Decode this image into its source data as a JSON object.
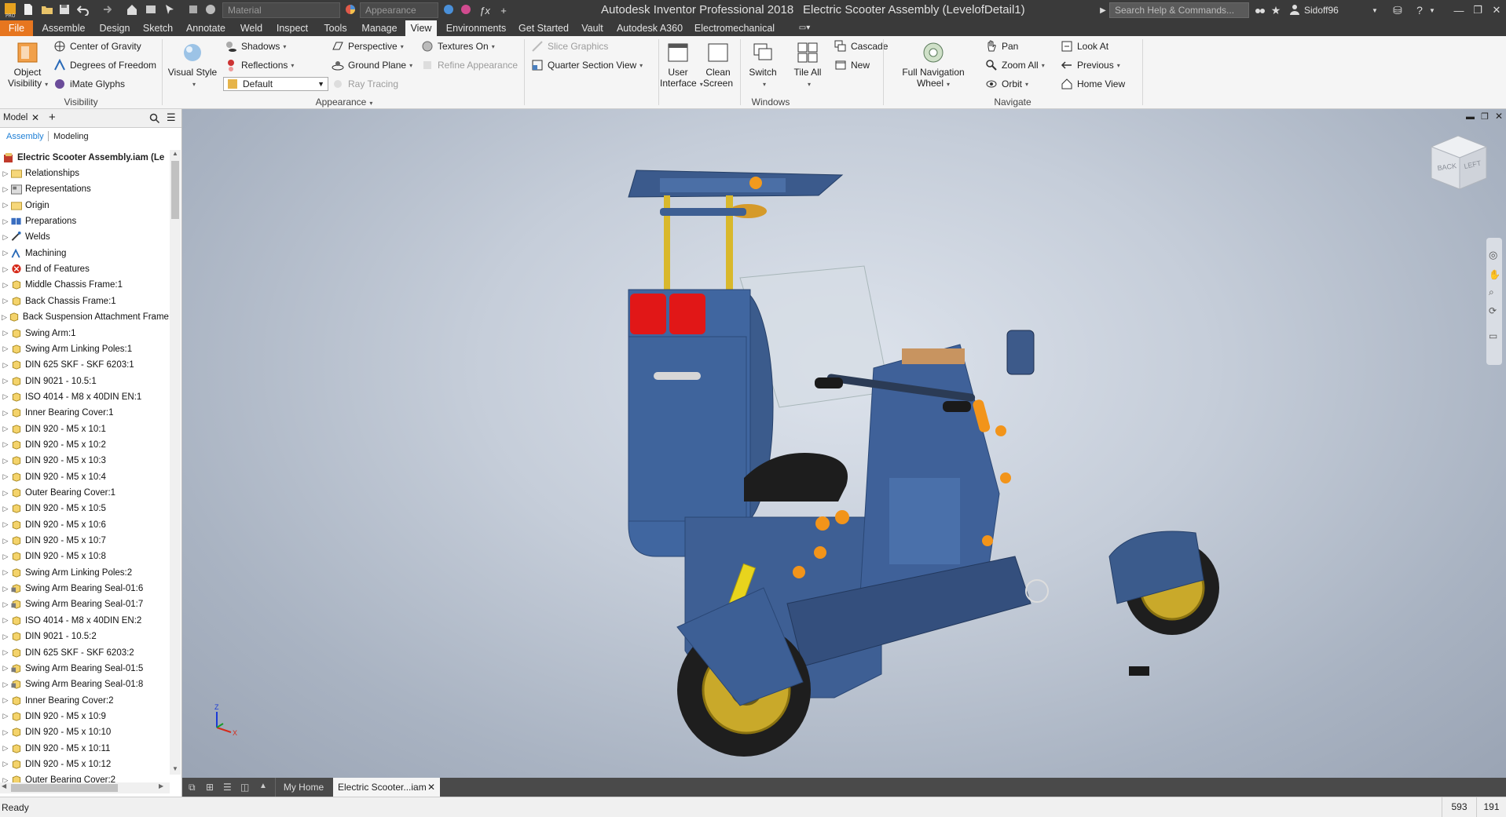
{
  "window": {
    "app_title": "Autodesk Inventor Professional 2018",
    "doc_title": "Electric Scooter Assembly (LevelofDetail1)",
    "search_placeholder": "Search Help & Commands...",
    "user": "Sidoff96",
    "material_combo": "Material",
    "appearance_combo": "Appearance"
  },
  "ribbon_tabs": [
    "File",
    "Assemble",
    "Design",
    "Sketch",
    "Annotate",
    "Weld",
    "Inspect",
    "Tools",
    "Manage",
    "View",
    "Environments",
    "Get Started",
    "Vault",
    "Autodesk A360",
    "Electromechanical"
  ],
  "ribbon": {
    "visibility": {
      "label": "Visibility",
      "object_visibility": [
        "Object",
        "Visibility"
      ],
      "items": [
        "Center of Gravity",
        "Degrees of Freedom",
        "iMate Glyphs"
      ]
    },
    "appearance": {
      "label": "Appearance",
      "visual_style": "Visual Style",
      "shadows": "Shadows",
      "reflections": "Reflections",
      "style_value": "Default",
      "perspective": "Perspective",
      "ground_plane": "Ground Plane",
      "ray_tracing": "Ray Tracing",
      "textures": "Textures On",
      "refine": "Refine Appearance",
      "slice": "Slice Graphics",
      "quarter": "Quarter Section View"
    },
    "windows": {
      "label": "Windows",
      "user_interface": [
        "User",
        "Interface"
      ],
      "clean_screen": [
        "Clean",
        "Screen"
      ],
      "switch": "Switch",
      "tile_all": "Tile All",
      "cascade": "Cascade",
      "new": "New"
    },
    "navigate": {
      "label": "Navigate",
      "full_nav": [
        "Full Navigation",
        "Wheel"
      ],
      "pan": "Pan",
      "zoom_all": "Zoom All",
      "orbit": "Orbit",
      "look_at": "Look At",
      "previous": "Previous",
      "home_view": "Home View"
    }
  },
  "browser": {
    "tab": "Model",
    "subtabs": [
      "Assembly",
      "Modeling"
    ],
    "root": "Electric Scooter Assembly.iam (Le",
    "items": [
      {
        "label": "Relationships",
        "icon": "folder"
      },
      {
        "label": "Representations",
        "icon": "repr"
      },
      {
        "label": "Origin",
        "icon": "folder"
      },
      {
        "label": "Preparations",
        "icon": "prep"
      },
      {
        "label": "Welds",
        "icon": "weld"
      },
      {
        "label": "Machining",
        "icon": "mach"
      },
      {
        "label": "End of Features",
        "icon": "eof"
      },
      {
        "label": "Middle Chassis Frame:1",
        "icon": "part"
      },
      {
        "label": "Back Chassis Frame:1",
        "icon": "part"
      },
      {
        "label": "Back Suspension Attachment Frame:",
        "icon": "part"
      },
      {
        "label": "Swing Arm:1",
        "icon": "part"
      },
      {
        "label": "Swing Arm Linking Poles:1",
        "icon": "part"
      },
      {
        "label": "DIN 625 SKF - SKF 6203:1",
        "icon": "part"
      },
      {
        "label": "DIN 9021 - 10.5:1",
        "icon": "part"
      },
      {
        "label": "ISO 4014 - M8 x 40DIN EN:1",
        "icon": "part"
      },
      {
        "label": "Inner Bearing  Cover:1",
        "icon": "part"
      },
      {
        "label": "DIN 920 - M5 x 10:1",
        "icon": "part"
      },
      {
        "label": "DIN 920 - M5 x 10:2",
        "icon": "part"
      },
      {
        "label": "DIN 920 - M5 x 10:3",
        "icon": "part"
      },
      {
        "label": "DIN 920 - M5 x 10:4",
        "icon": "part"
      },
      {
        "label": "Outer Bearing Cover:1",
        "icon": "part"
      },
      {
        "label": "DIN 920 - M5 x 10:5",
        "icon": "part"
      },
      {
        "label": "DIN 920 - M5 x 10:6",
        "icon": "part"
      },
      {
        "label": "DIN 920 - M5 x 10:7",
        "icon": "part"
      },
      {
        "label": "DIN 920 - M5 x 10:8",
        "icon": "part"
      },
      {
        "label": "Swing Arm Linking Poles:2",
        "icon": "part"
      },
      {
        "label": "Swing Arm Bearing Seal-01:6",
        "icon": "asm"
      },
      {
        "label": "Swing Arm Bearing Seal-01:7",
        "icon": "asm"
      },
      {
        "label": "ISO 4014 - M8 x 40DIN EN:2",
        "icon": "part"
      },
      {
        "label": "DIN 9021 - 10.5:2",
        "icon": "part"
      },
      {
        "label": "DIN 625 SKF - SKF 6203:2",
        "icon": "part"
      },
      {
        "label": "Swing Arm Bearing Seal-01:5",
        "icon": "asm"
      },
      {
        "label": "Swing Arm Bearing Seal-01:8",
        "icon": "asm"
      },
      {
        "label": "Inner Bearing  Cover:2",
        "icon": "part"
      },
      {
        "label": "DIN 920 - M5 x 10:9",
        "icon": "part"
      },
      {
        "label": "DIN 920 - M5 x 10:10",
        "icon": "part"
      },
      {
        "label": "DIN 920 - M5 x 10:11",
        "icon": "part"
      },
      {
        "label": "DIN 920 - M5 x 10:12",
        "icon": "part"
      },
      {
        "label": "Outer Bearing Cover:2",
        "icon": "part"
      }
    ]
  },
  "viewcube": {
    "face1": "BACK",
    "face2": "LEFT"
  },
  "triad": {
    "z": "Z",
    "x": "X"
  },
  "doc_tabs": [
    "My Home",
    "Electric Scooter...iam"
  ],
  "status": {
    "text": "Ready",
    "num1": "593",
    "num2": "191"
  },
  "colors": {
    "file_tab": "#e7761f",
    "accent": "#1e7fd6",
    "scooter_body": "#3f5f8f"
  }
}
